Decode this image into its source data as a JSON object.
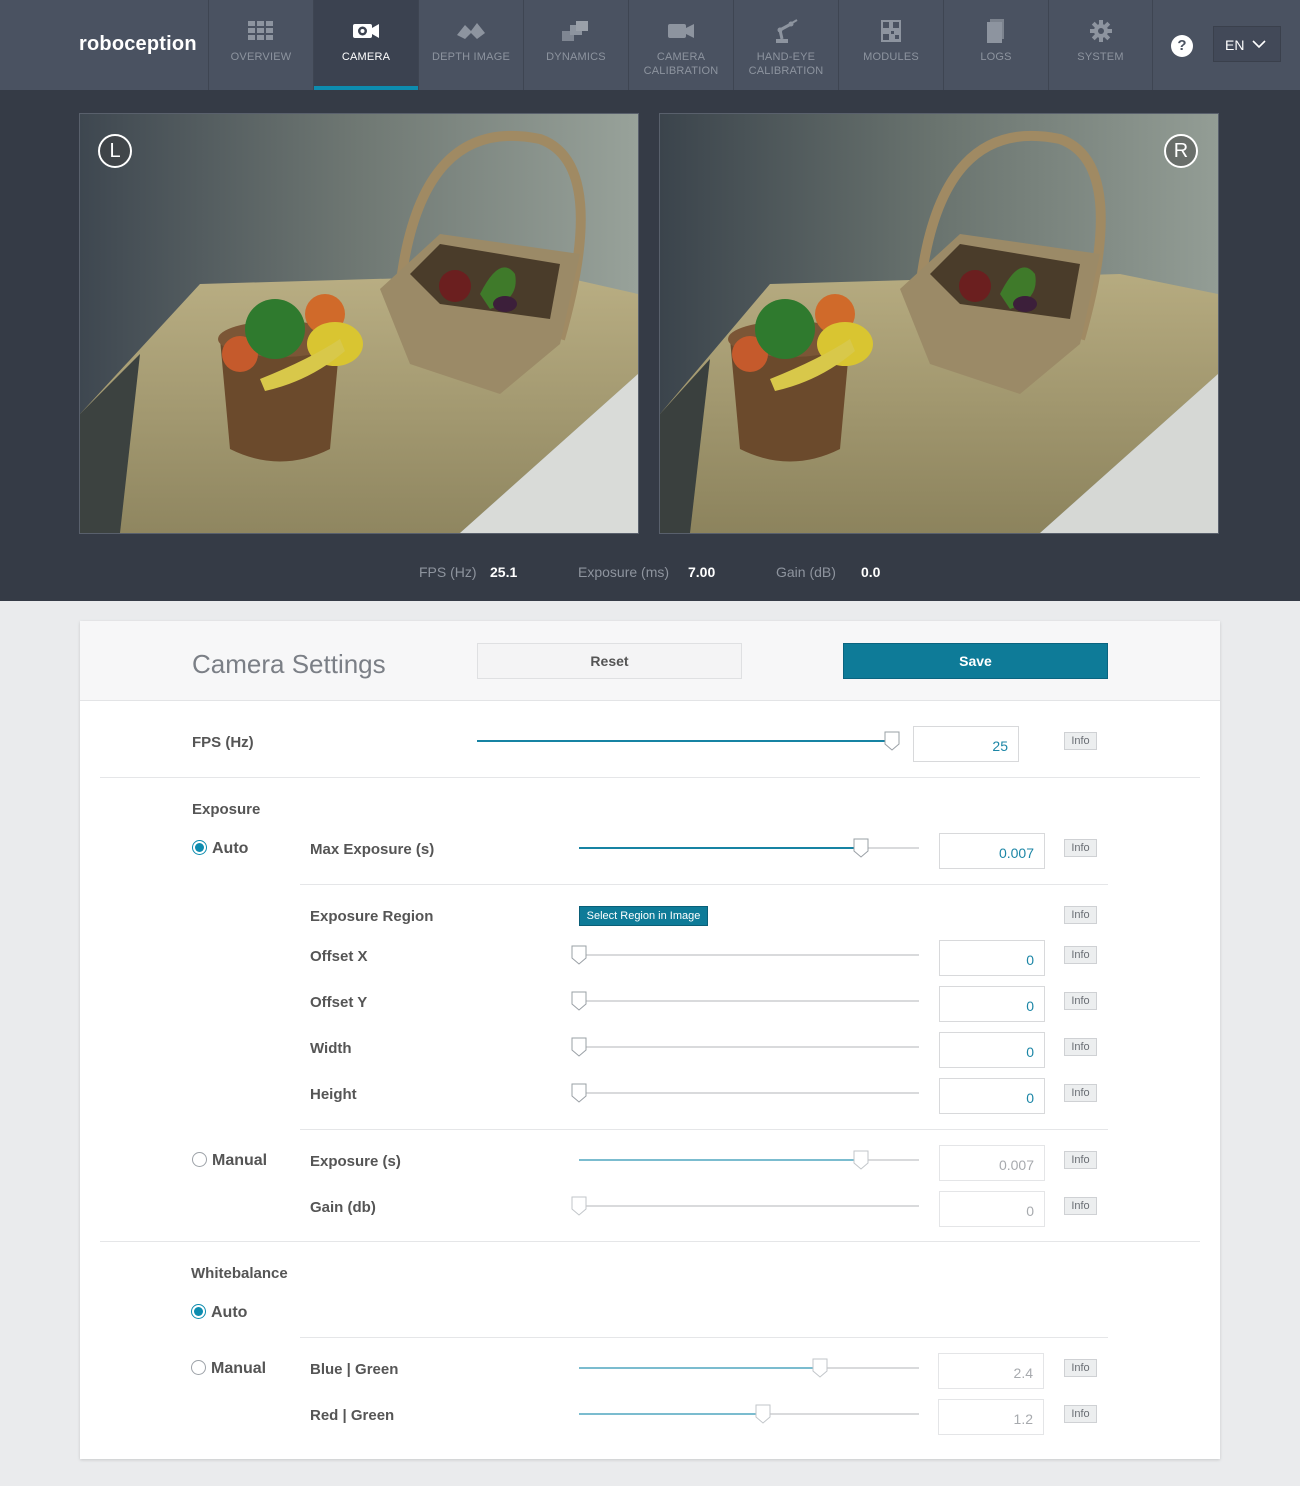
{
  "brand": "roboception",
  "nav": {
    "items": [
      {
        "label": "OVERVIEW",
        "icon": "grid-icon"
      },
      {
        "label": "CAMERA",
        "icon": "camera-gear-icon",
        "active": true
      },
      {
        "label": "DEPTH IMAGE",
        "icon": "depth-icon"
      },
      {
        "label": "DYNAMICS",
        "icon": "dynamics-icon"
      },
      {
        "label": "CAMERA CALIBRATION",
        "icon": "video-camera-icon"
      },
      {
        "label": "HAND-EYE CALIBRATION",
        "icon": "robot-arm-icon"
      },
      {
        "label": "MODULES",
        "icon": "qr-code-icon"
      },
      {
        "label": "LOGS",
        "icon": "document-icon"
      },
      {
        "label": "SYSTEM",
        "icon": "gear-icon"
      }
    ],
    "help_label": "?",
    "language": "EN"
  },
  "camera": {
    "left_tag": "L",
    "right_tag": "R",
    "stats": {
      "fps_label": "FPS (Hz)",
      "fps_value": "25.1",
      "exposure_label": "Exposure (ms)",
      "exposure_value": "7.00",
      "gain_label": "Gain (dB)",
      "gain_value": "0.0"
    }
  },
  "settings": {
    "title": "Camera Settings",
    "reset_label": "Reset",
    "save_label": "Save",
    "info_label": "Info",
    "fps": {
      "label": "FPS (Hz)",
      "value": "25",
      "level": 1.0
    },
    "exposure": {
      "section": "Exposure",
      "auto_label": "Auto",
      "manual_label": "Manual",
      "mode": "auto",
      "max_exposure": {
        "label": "Max Exposure (s)",
        "value": "0.007",
        "level": 0.83
      },
      "region_label": "Exposure Region",
      "region_button": "Select Region in Image",
      "offset_x": {
        "label": "Offset X",
        "value": "0",
        "level": 0
      },
      "offset_y": {
        "label": "Offset Y",
        "value": "0",
        "level": 0
      },
      "width": {
        "label": "Width",
        "value": "0",
        "level": 0
      },
      "height": {
        "label": "Height",
        "value": "0",
        "level": 0
      },
      "manual_exposure": {
        "label": "Exposure (s)",
        "value": "0.007",
        "level": 0.83
      },
      "gain": {
        "label": "Gain (db)",
        "value": "0",
        "level": 0
      }
    },
    "whitebalance": {
      "section": "Whitebalance",
      "auto_label": "Auto",
      "manual_label": "Manual",
      "mode": "auto",
      "blue_green": {
        "label": "Blue | Green",
        "value": "2.4",
        "level": 0.71
      },
      "red_green": {
        "label": "Red | Green",
        "value": "1.2",
        "level": 0.54
      }
    }
  },
  "colors": {
    "accent": "#0d8caf",
    "nav_bg": "#4a5261",
    "view_bg": "#353b46"
  }
}
